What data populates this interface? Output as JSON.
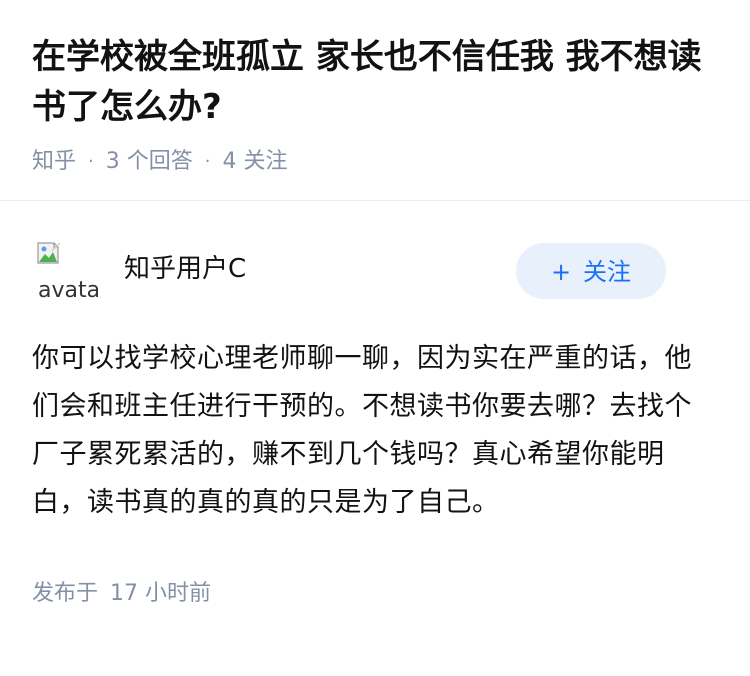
{
  "question": {
    "title": "在学校被全班孤立 家长也不信任我 我不想读书了怎么办?",
    "source": "知乎",
    "answers": "3 个回答",
    "follows": "4 关注"
  },
  "answer": {
    "avatar_alt": "avatar",
    "author_name": "知乎用户C",
    "follow_label": "关注",
    "follow_icon": "+",
    "content": "你可以找学校心理老师聊一聊，因为实在严重的话，他们会和班主任进行干预的。不想读书你要去哪？去找个厂子累死累活的，赚不到几个钱吗？真心希望你能明白，读书真的真的真的只是为了自己。",
    "time_label": "发布于",
    "time_value": "17 小时前"
  },
  "colors": {
    "meta_text": "#8590a6",
    "accent": "#1772f6",
    "follow_bg": "#e8f0fc",
    "divider": "#eeeeee"
  }
}
